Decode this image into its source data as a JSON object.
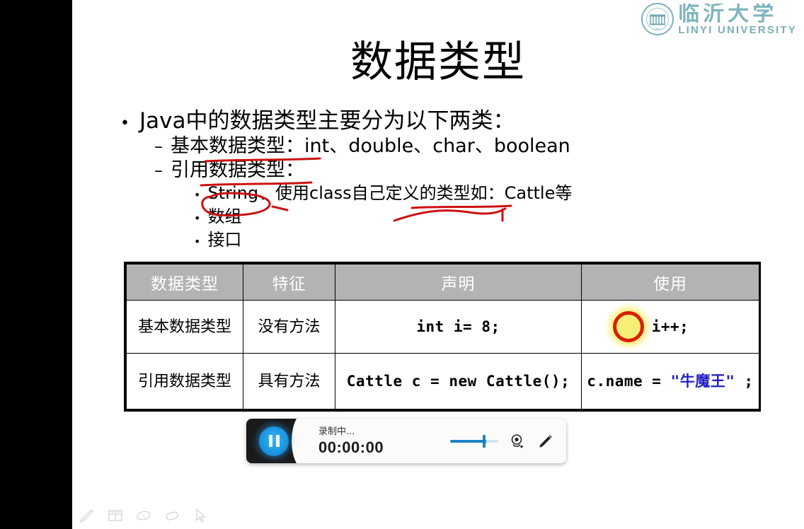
{
  "window": {
    "letterbox_color": "#000000",
    "slide_background": "#ffffff"
  },
  "logo": {
    "seal_year": "1941",
    "chinese_name": "临沂大学",
    "english_name": "LINYI UNIVERSITY",
    "color": "#7fb5be"
  },
  "slide": {
    "title": "数据类型",
    "bullets": {
      "level1": "Java中的数据类型主要分为以下两类：",
      "level2_a": "基本数据类型：int、double、char、boolean",
      "level2_b": "引用数据类型：",
      "level3_a": "String、使用class自己定义的类型如：Cattle等",
      "level3_b": "数组",
      "level3_c": "接口"
    },
    "bullet_marks": {
      "level1": "•",
      "level2": "–",
      "level3": "•"
    }
  },
  "annotations": {
    "ink_color": "#cc1111",
    "items": [
      "underline-under-jiben-shuju-leixing",
      "underline-under-yinyong-shuju-leixing",
      "circle-around-String",
      "underline-under-ziji-dingyi",
      "check-squiggle-below-class-text"
    ],
    "spotlight": {
      "name": "yellow-spotlight-circle",
      "fill": "#f6ef77",
      "ring": "#d81f00"
    }
  },
  "table": {
    "headers": [
      "数据类型",
      "特征",
      "声明",
      "使用"
    ],
    "header_bg": "#b3b3b3",
    "header_color": "#ffffff",
    "rows": [
      {
        "type": "基本数据类型",
        "feature": "没有方法",
        "declaration": "int i= 8;",
        "usage": "i++;",
        "usage_plain": "i++;",
        "usage_string_literal": ""
      },
      {
        "type": "引用数据类型",
        "feature": "具有方法",
        "declaration": "Cattle c = new Cattle();",
        "usage": "c.name = \"牛魔王\" ;",
        "usage_plain": "c.name = ",
        "usage_string_literal": "\"牛魔王\"",
        "usage_tail": " ;",
        "string_literal_color": "#2222cc"
      }
    ]
  },
  "recorder": {
    "pause_button_label": "pause",
    "status_label": "录制中...",
    "elapsed_time": "00:00:00",
    "volume_percent": 75,
    "accent_color": "#1a82c4",
    "icons": [
      "webcam-icon",
      "pencil-icon"
    ]
  },
  "ink_toolbar": {
    "tools": [
      "pen-icon",
      "table-icon",
      "ellipse-icon",
      "eraser-icon",
      "cursor-icon"
    ]
  }
}
